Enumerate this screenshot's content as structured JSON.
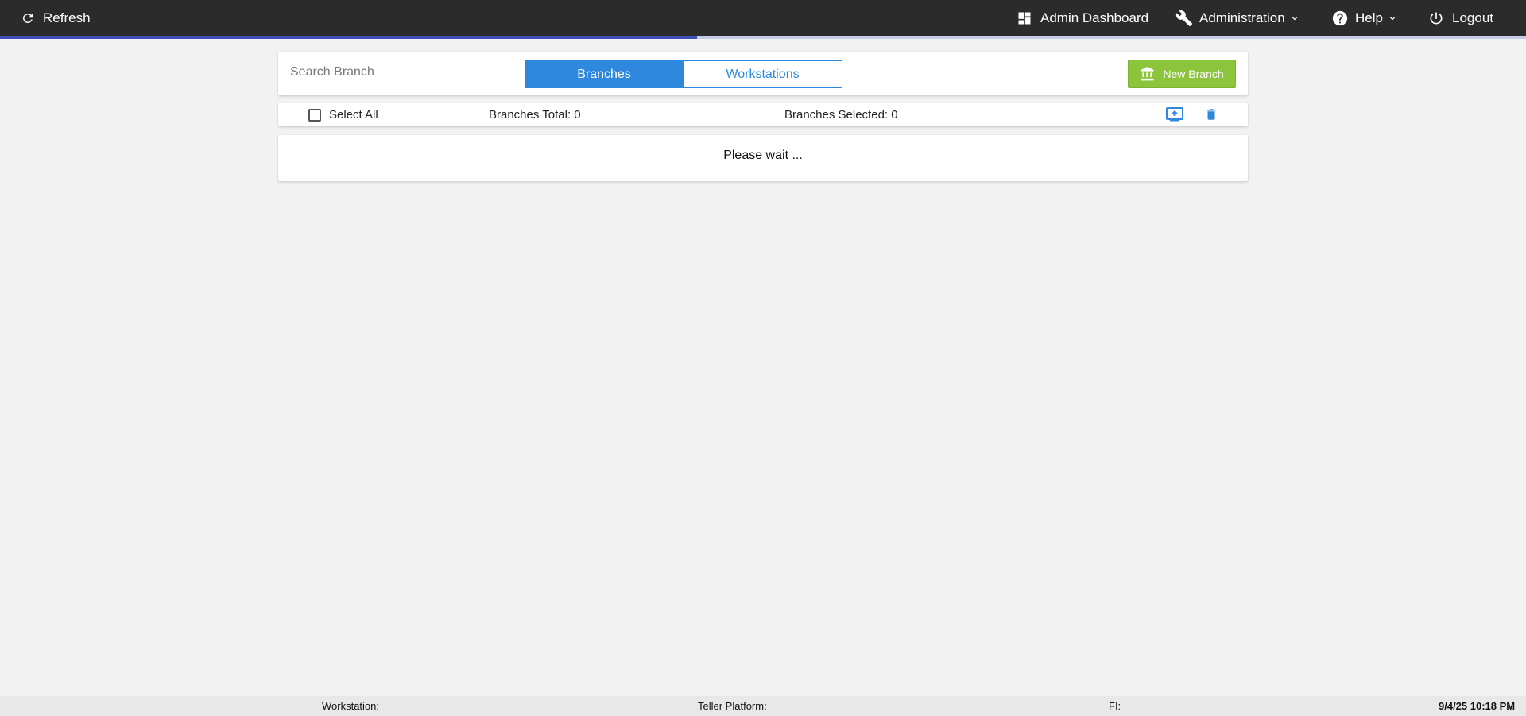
{
  "header": {
    "refresh_label": "Refresh",
    "admin_dashboard_label": "Admin Dashboard",
    "administration_label": "Administration",
    "help_label": "Help",
    "logout_label": "Logout"
  },
  "loading_progress": 0.457,
  "toolbar": {
    "search_placeholder": "Search Branch",
    "search_value": "",
    "tabs": [
      {
        "label": "Branches",
        "active": true
      },
      {
        "label": "Workstations",
        "active": false
      }
    ],
    "new_branch_label": "New Branch"
  },
  "stats": {
    "select_all_label": "Select All",
    "select_all_checked": false,
    "branches_total": "Branches Total: 0",
    "branches_selected": "Branches Selected: 0"
  },
  "status": {
    "message": "Please wait ..."
  },
  "footer": {
    "workstation": "Workstation:",
    "teller_platform": "Teller Platform:",
    "fi": "FI:",
    "datetime": "9/4/25 10:18 PM"
  },
  "icons": {
    "refresh": "refresh-icon",
    "dashboard": "dashboard-icon",
    "wrench": "wrench-icon",
    "help": "help-circle-icon",
    "power": "power-icon",
    "bank": "bank-icon",
    "upload": "upload-icon",
    "trash": "trash-icon"
  },
  "colors": {
    "topbar": "#2b2b2b",
    "progress": "#3f51b5",
    "accent_blue": "#2e88de",
    "new_branch_green": "#8cc43c"
  }
}
